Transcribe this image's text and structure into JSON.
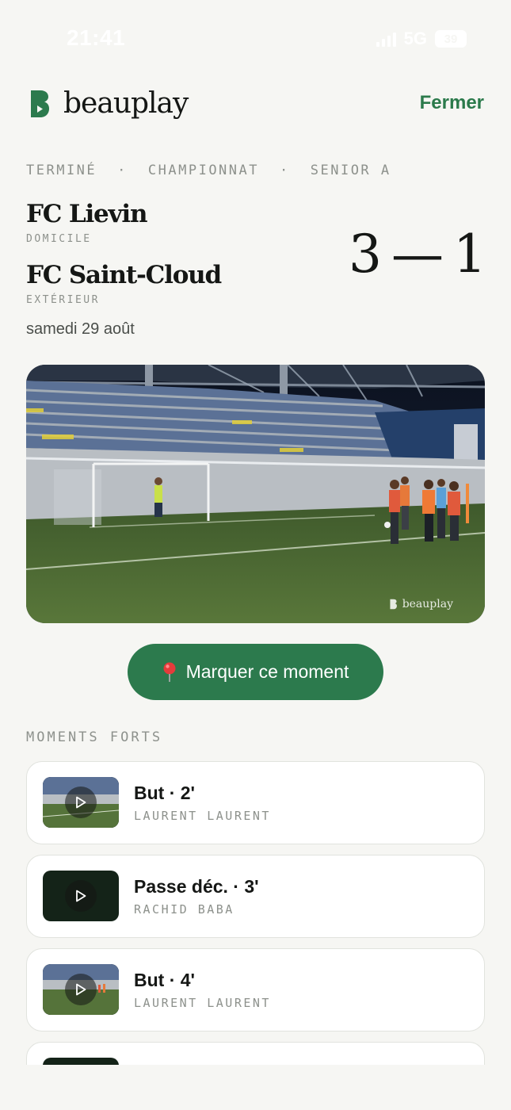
{
  "status_bar": {
    "time": "21:41",
    "network": "5G",
    "battery": "39"
  },
  "header": {
    "brand": "beauplay",
    "close_label": "Fermer"
  },
  "match": {
    "status": "TERMINÉ",
    "competition": "CHAMPIONNAT",
    "category": "SENIOR A",
    "separator": "·",
    "home": {
      "name": "FC Lievin",
      "role": "DOMICILE",
      "score": "3"
    },
    "away": {
      "name": "FC Saint-Cloud",
      "role": "EXTÉRIEUR",
      "score": "1"
    },
    "score_separator": "—",
    "date": "samedi 29 août"
  },
  "video": {
    "watermark": "beauplay"
  },
  "mark_button": {
    "icon": "pin-icon",
    "label": "Marquer ce moment"
  },
  "highlights": {
    "title": "MOMENTS FORTS",
    "items": [
      {
        "title": "But · 2'",
        "player": "LAURENT LAURENT",
        "thumb": "field"
      },
      {
        "title": "Passe déc. · 3'",
        "player": "RACHID BABA",
        "thumb": "dark"
      },
      {
        "title": "But · 4'",
        "player": "LAURENT LAURENT",
        "thumb": "field"
      },
      {
        "title": "",
        "player": "",
        "thumb": "dark"
      }
    ]
  },
  "colors": {
    "accent": "#2c7a4d",
    "background": "#f6f6f3",
    "muted": "#8d918c"
  }
}
